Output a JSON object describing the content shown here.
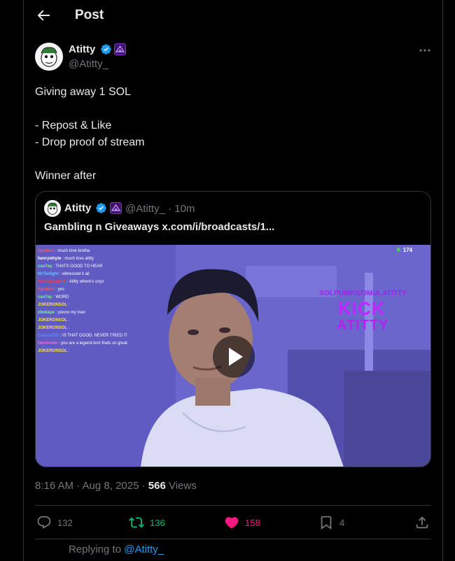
{
  "header": {
    "title": "Post"
  },
  "author": {
    "name": "Atitty",
    "handle": "@Atitty_"
  },
  "post": {
    "lines": [
      "Giving away 1 SOL",
      "",
      "- Repost & Like",
      "- Drop proof of stream",
      "",
      "Winner after"
    ]
  },
  "quote": {
    "name": "Atitty",
    "handle_time": "@Atitty_ · 10m",
    "text": "Gambling n Giveaways x.com/i/broadcasts/1...",
    "video": {
      "viewer_count": "174",
      "overlay_sub": "SOLPUMP.COM/A.ATITTY",
      "overlay_kick": "KICK",
      "overlay_name": "ATITTY",
      "chat": [
        {
          "user": "Apstevs",
          "msg": "much love brotha",
          "color": "#ff5c5c"
        },
        {
          "user": "henrywhyte",
          "msg": "much love atitty",
          "color": "#ffffff"
        },
        {
          "user": "cau7ay",
          "msg": "THATS GOOD TO HEAR",
          "color": "#7cff7c"
        },
        {
          "user": "MrTwilight",
          "msg": "witnessed it all",
          "color": "#5cc8ff"
        },
        {
          "user": "thekleyeagent",
          "msg": "Atitty where's onyx",
          "color": "#ff3b3b"
        },
        {
          "user": "Apstevs",
          "msg": "yes",
          "color": "#ff5c5c"
        },
        {
          "user": "cau7ay",
          "msg": "WORD",
          "color": "#7cff7c"
        },
        {
          "user": "JOKERONSOL",
          "msg": "",
          "color": "#ffe14d"
        },
        {
          "user": "zbokaye",
          "msg": "yoooo my man",
          "color": "#7cff7c"
        },
        {
          "user": "JOKERONSOL",
          "msg": "",
          "color": "#ffe14d"
        },
        {
          "user": "JOKERONSOL",
          "msg": "",
          "color": "#ffe14d"
        },
        {
          "user": "CaesarZIO",
          "msg": "IS THAT GOOD. NEVER TRIED IT",
          "color": "#5c8cff"
        },
        {
          "user": "Hermonte",
          "msg": "you are a legend bro! thats so great",
          "color": "#ff6bd6"
        },
        {
          "user": "JOKERONSOL",
          "msg": "",
          "color": "#ffe14d"
        }
      ]
    }
  },
  "meta": {
    "time_date": "8:16 AM · Aug 8, 2025 · ",
    "views_count": "566",
    "views_label": " Views"
  },
  "actions": {
    "replies": "132",
    "reposts": "136",
    "likes": "158",
    "bookmarks": "4"
  },
  "reply": {
    "prefix": "Replying to ",
    "mention": "@Atitty_"
  },
  "colors": {
    "accent": "#1d9bf0",
    "repost": "#00ba7c",
    "like": "#f91880",
    "muted": "#71767b",
    "affiliate": "#8a2be2"
  }
}
